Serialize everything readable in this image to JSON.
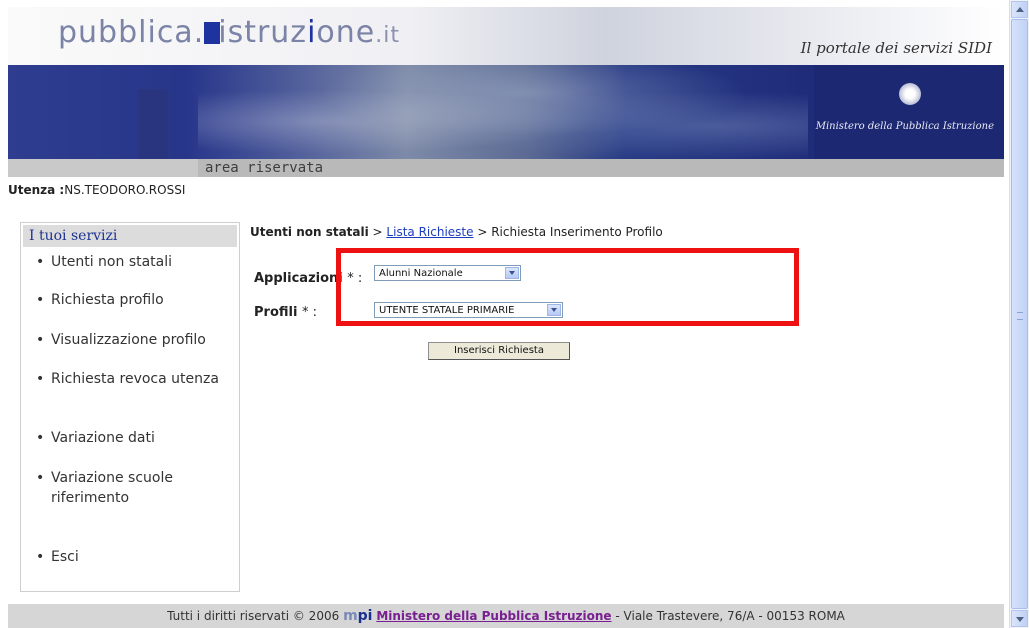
{
  "header": {
    "logo_prefix": "pubblica.",
    "logo_mid": "istruz",
    "logo_i": "i",
    "logo_suffix": "one",
    "logo_tld": ".it",
    "portal_tagline": "Il portale dei servizi SIDI",
    "ministry": "Ministero della Pubblica Istruzione",
    "area": "area riservata"
  },
  "user": {
    "label": "Utenza :",
    "value": "NS.TEODORO.ROSSI"
  },
  "sidebar": {
    "title": "I tuoi servizi",
    "items": [
      {
        "label": "Utenti non statali"
      },
      {
        "label": "Richiesta profilo"
      },
      {
        "label": "Visualizzazione profilo"
      },
      {
        "label": "Richiesta revoca utenza"
      },
      {
        "label": "Variazione dati"
      },
      {
        "label": "Variazione scuole riferimento"
      },
      {
        "label": "Esci"
      }
    ]
  },
  "breadcrumb": {
    "root": "Utenti non statali",
    "sep": " > ",
    "link": "Lista Richieste",
    "current": "Richiesta Inserimento Profilo"
  },
  "form": {
    "app_label": "Applicazioni",
    "profili_label": "Profili",
    "required_mark": "* :",
    "app_value": "Alunni Nazionale",
    "profilo_value": "UTENTE STATALE PRIMARIE",
    "submit_label": "Inserisci Richiesta"
  },
  "footer": {
    "rights": "Tutti i diritti riservati © 2006",
    "logo_m": "m",
    "logo_pi": "pi",
    "ministry_link": "Ministero della Pubblica Istruzione",
    "address": " - Viale Trastevere, 76/A - 00153 ROMA"
  },
  "colors": {
    "highlight": "#ee1111",
    "brand_blue": "#1f33a0",
    "link": "#1a3dbf",
    "footer_link": "#7a1f91"
  }
}
